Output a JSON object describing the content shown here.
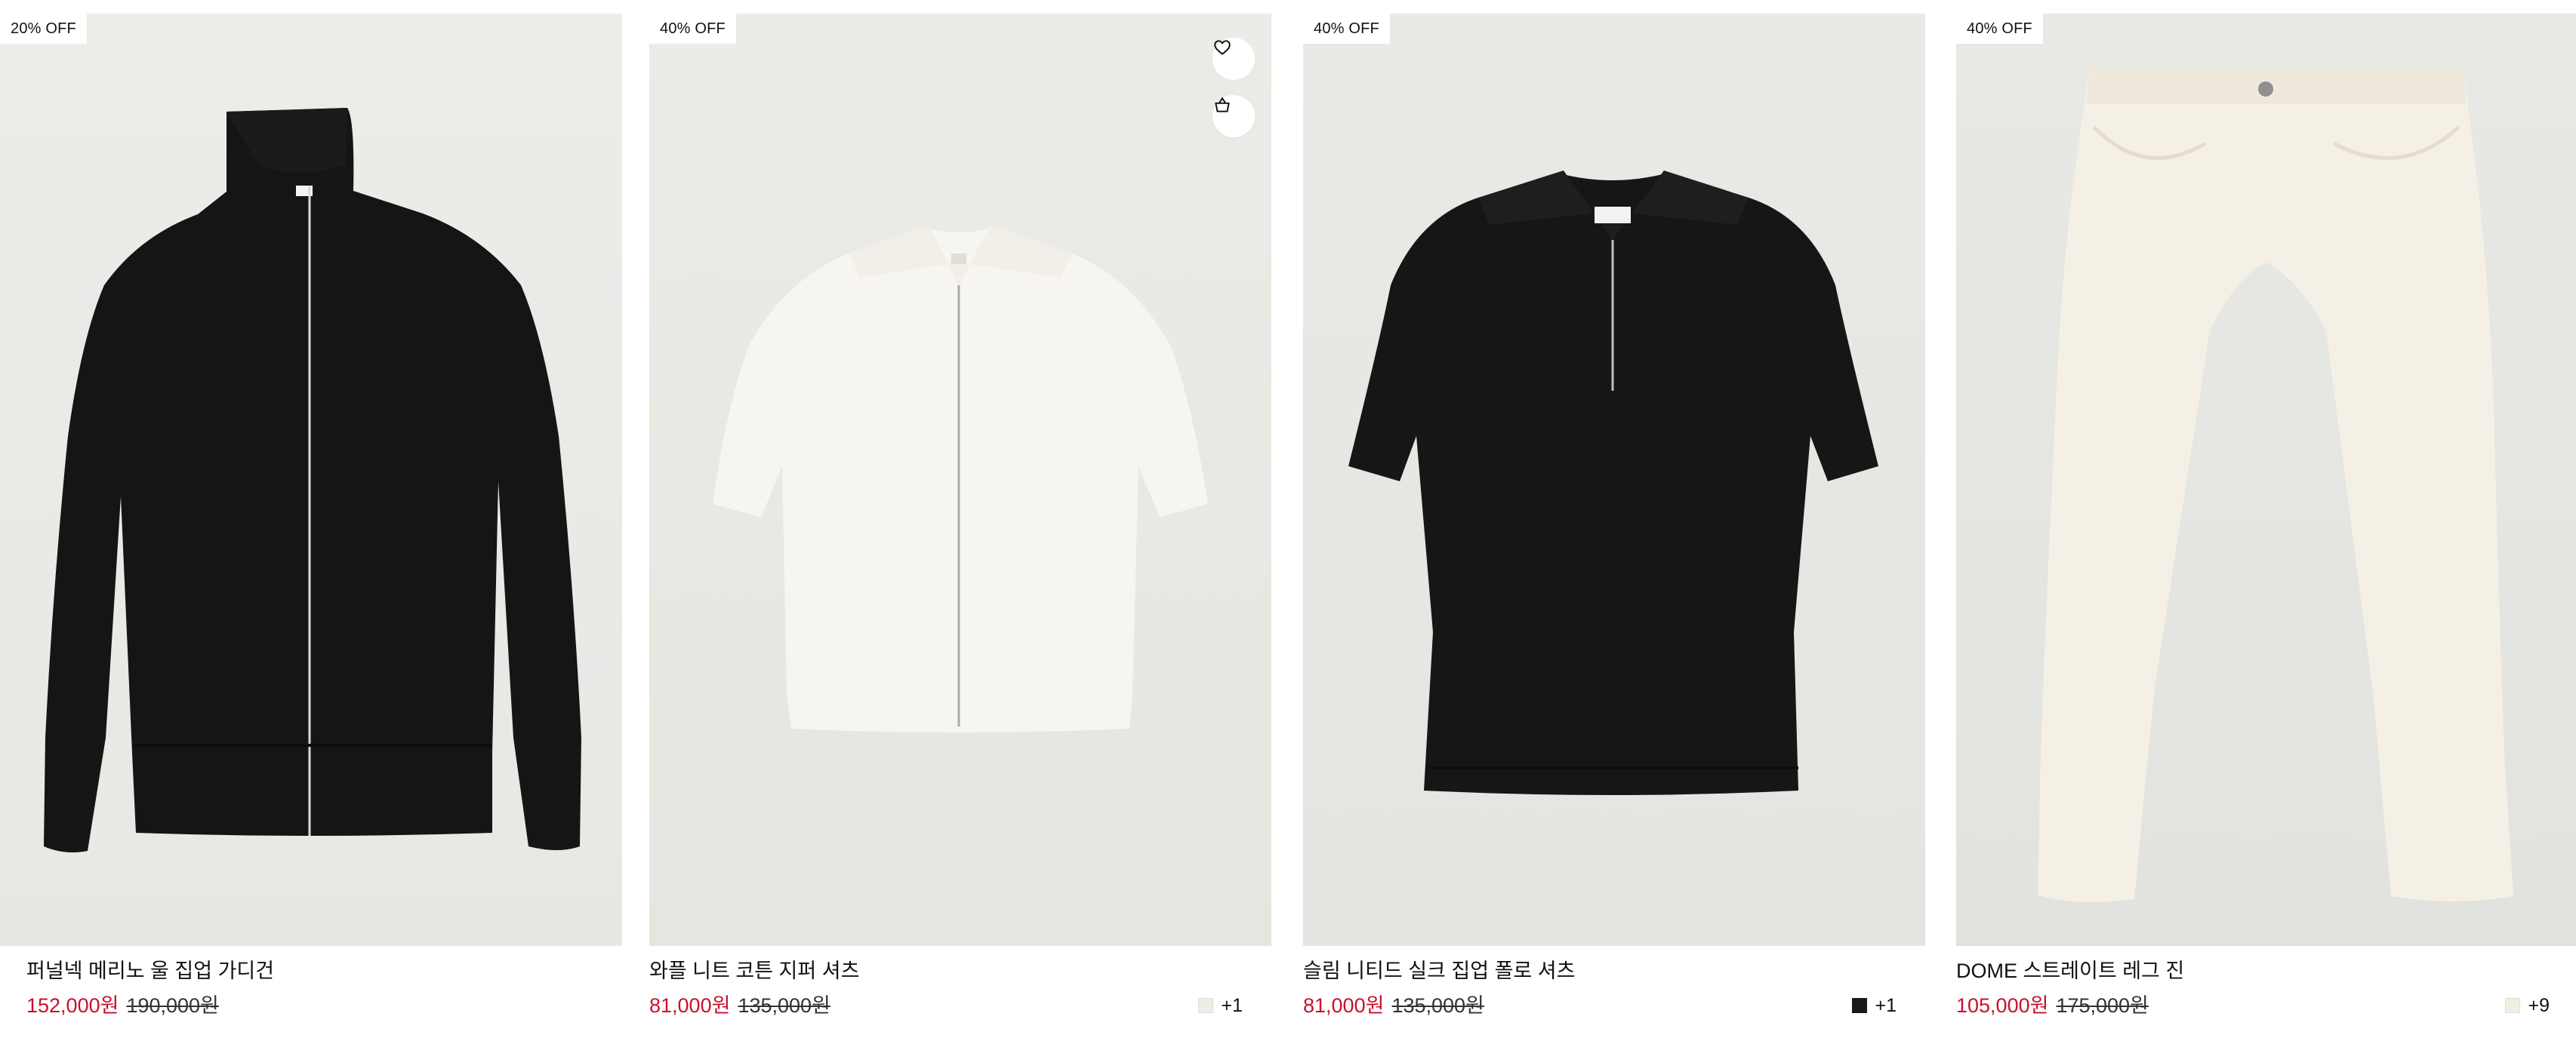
{
  "products": [
    {
      "badge": "20% OFF",
      "name": "퍼널넥 메리노 울 집업 가디건",
      "sale_price": "152,000원",
      "original_price": "190,000원",
      "garment_color": "#141414",
      "swatch_color": "",
      "more_colors": ""
    },
    {
      "badge": "40% OFF",
      "name": "와플 니트 코튼 지퍼 셔츠",
      "sale_price": "81,000원",
      "original_price": "135,000원",
      "garment_color": "#f6f4ee",
      "swatch_color": "#efeee6",
      "more_colors": "+1"
    },
    {
      "badge": "40% OFF",
      "name": "슬림 니티드 실크 집업 폴로 셔츠",
      "sale_price": "81,000원",
      "original_price": "135,000원",
      "garment_color": "#151515",
      "swatch_color": "#1a1a1a",
      "more_colors": "+1"
    },
    {
      "badge": "40% OFF",
      "name": "DOME 스트레이트 레그 진",
      "sale_price": "105,000원",
      "original_price": "175,000원",
      "garment_color": "#f4efe4",
      "swatch_color": "#f3eee1",
      "more_colors": "+9"
    }
  ],
  "colors": {
    "sale": "#c8102e",
    "badge_bg": "#ffffff"
  },
  "icons": {
    "wishlist": "heart-icon",
    "bag": "shopping-bag-icon"
  }
}
